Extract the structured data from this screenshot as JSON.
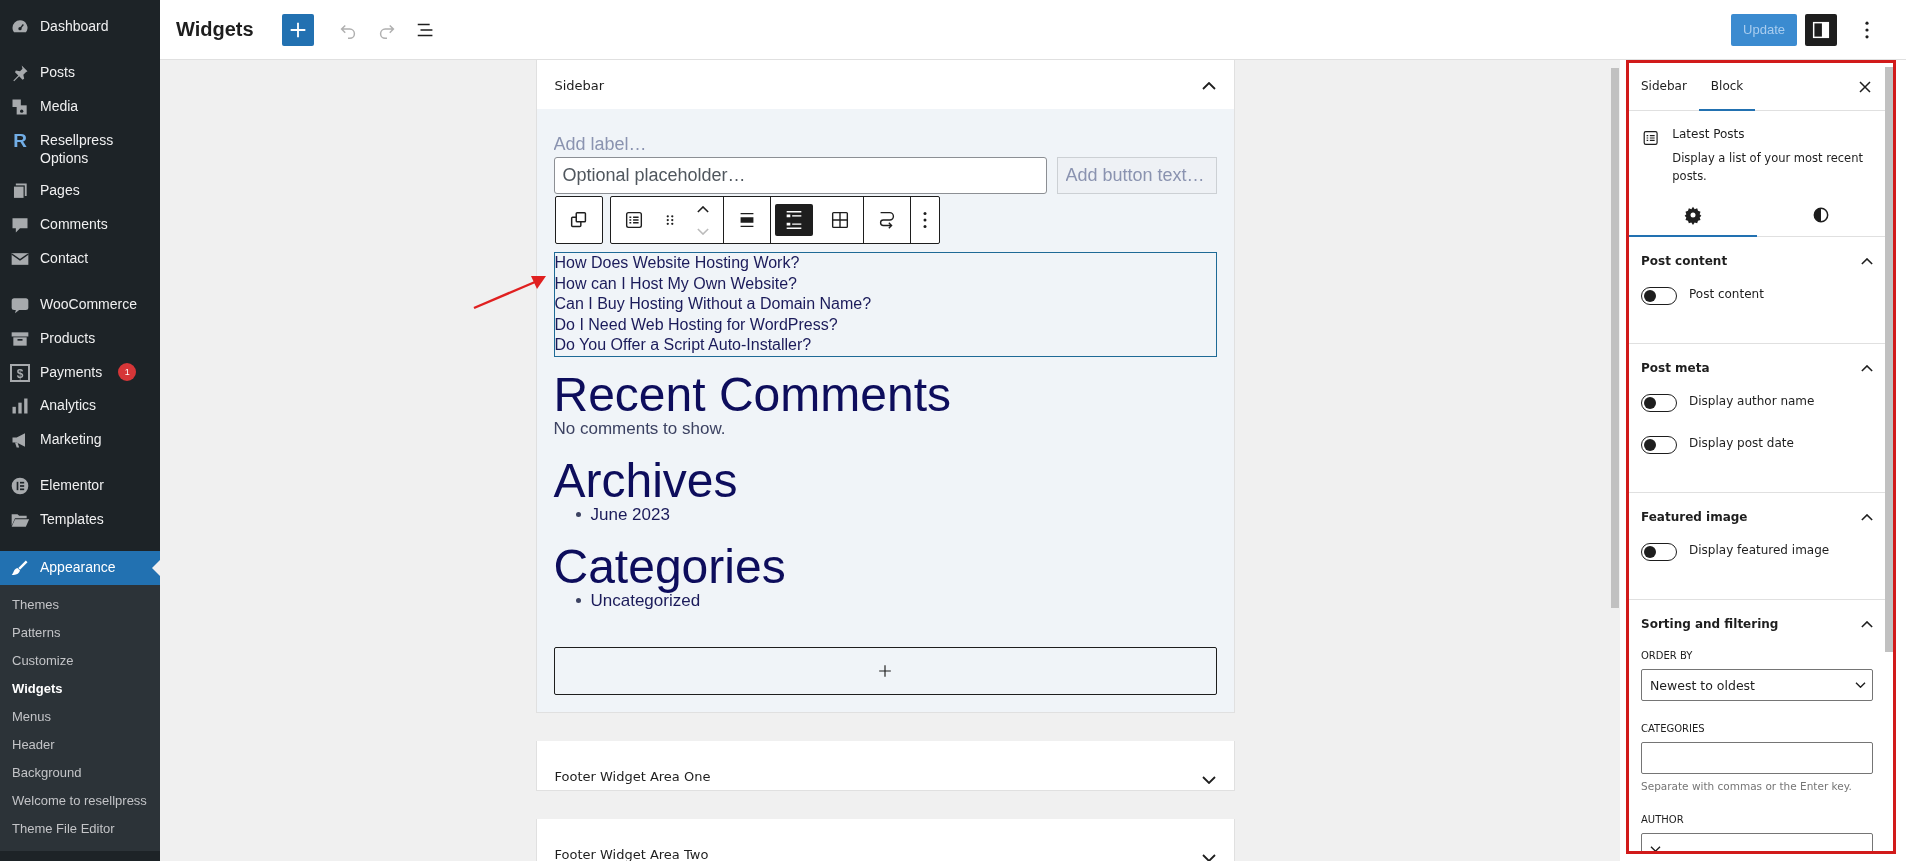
{
  "admin_menu": {
    "groups": [
      {
        "items": [
          {
            "label": "Dashboard",
            "selected": false
          }
        ]
      },
      {
        "items": [
          {
            "label": "Posts",
            "selected": false
          },
          {
            "label": "Media",
            "selected": false
          },
          {
            "label": "Resellpress Options",
            "icon_text": "R",
            "selected": false
          },
          {
            "label": "Pages",
            "selected": false
          },
          {
            "label": "Comments",
            "selected": false
          },
          {
            "label": "Contact",
            "selected": false
          }
        ]
      },
      {
        "items": [
          {
            "label": "WooCommerce",
            "selected": false
          },
          {
            "label": "Products",
            "selected": false
          },
          {
            "label": "Payments",
            "icon_text": "$",
            "badge": "1",
            "selected": false
          },
          {
            "label": "Analytics",
            "selected": false
          },
          {
            "label": "Marketing",
            "selected": false
          }
        ]
      },
      {
        "items": [
          {
            "label": "Elementor",
            "selected": false
          },
          {
            "label": "Templates",
            "selected": false
          }
        ]
      },
      {
        "items": [
          {
            "label": "Appearance",
            "selected": true,
            "submenu": [
              {
                "label": "Themes",
                "selected": false
              },
              {
                "label": "Patterns",
                "selected": false
              },
              {
                "label": "Customize",
                "selected": false
              },
              {
                "label": "Widgets",
                "selected": true
              },
              {
                "label": "Menus",
                "selected": false
              },
              {
                "label": "Header",
                "selected": false
              },
              {
                "label": "Background",
                "selected": false
              },
              {
                "label": "Welcome to resellpress",
                "selected": false
              },
              {
                "label": "Theme File Editor",
                "selected": false
              }
            ]
          }
        ]
      }
    ]
  },
  "top_bar": {
    "title": "Widgets",
    "undo": {
      "disabled": true
    },
    "redo": {
      "disabled": true
    },
    "update_button": {
      "label": "Update",
      "disabled": true
    },
    "settings_toggle": {
      "pressed": true
    }
  },
  "widget_areas": [
    {
      "title": "Sidebar",
      "expanded": true,
      "block_toolbar": {
        "layout_options": [
          {
            "selected": true
          },
          {
            "selected": false
          }
        ]
      },
      "blocks": [
        {
          "kind": "search",
          "label_placeholder": "Add label…",
          "placeholder": "Optional placeholder…",
          "button_placeholder": "Add button text…"
        },
        {
          "kind": "latest-posts",
          "selected": true,
          "posts": [
            "How Does Website Hosting Work?",
            "How can I Host My Own Website?",
            "Can I Buy Hosting Without a Domain Name?",
            "Do I Need Web Hosting for WordPress?",
            "Do You Offer a Script Auto-Installer?"
          ]
        },
        {
          "kind": "comments",
          "heading": "Recent Comments",
          "text": "No comments to show."
        },
        {
          "kind": "list",
          "heading": "Archives",
          "items": [
            "June 2023"
          ]
        },
        {
          "kind": "list",
          "heading": "Categories",
          "items": [
            "Uncategorized"
          ]
        }
      ]
    },
    {
      "title": "Footer Widget Area One",
      "expanded": false
    },
    {
      "title": "Footer Widget Area Two",
      "expanded": false
    }
  ],
  "settings_panel": {
    "tabs": [
      {
        "label": "Sidebar",
        "selected": false
      },
      {
        "label": "Block",
        "selected": true
      }
    ],
    "block": {
      "title": "Latest Posts",
      "description": "Display a list of your most recent posts."
    },
    "style_tabs": [
      {
        "selected": true
      },
      {
        "selected": false
      }
    ],
    "sections": [
      {
        "title": "Post content",
        "expanded": true,
        "controls": [
          {
            "kind": "toggle",
            "label": "Post content",
            "on": false
          }
        ]
      },
      {
        "title": "Post meta",
        "expanded": true,
        "controls": [
          {
            "kind": "toggle",
            "label": "Display author name",
            "on": false
          },
          {
            "kind": "toggle",
            "label": "Display post date",
            "on": false
          }
        ]
      },
      {
        "title": "Featured image",
        "expanded": true,
        "controls": [
          {
            "kind": "toggle",
            "label": "Display featured image",
            "on": false
          }
        ]
      },
      {
        "title": "Sorting and filtering",
        "expanded": true,
        "controls": [
          {
            "kind": "select",
            "label": "ORDER BY",
            "value": "Newest to oldest"
          },
          {
            "kind": "tokens",
            "label": "CATEGORIES",
            "help": "Separate with commas or the Enter key."
          },
          {
            "kind": "select",
            "label": "AUTHOR"
          }
        ]
      }
    ]
  }
}
